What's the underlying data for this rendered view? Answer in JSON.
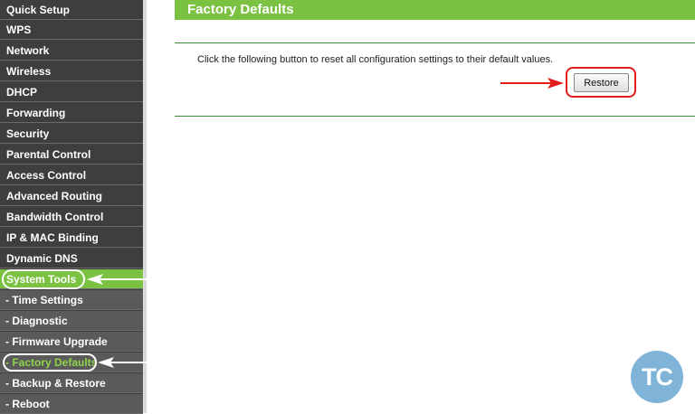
{
  "sidebar": {
    "items": [
      {
        "label": "Quick Setup"
      },
      {
        "label": "WPS"
      },
      {
        "label": "Network"
      },
      {
        "label": "Wireless"
      },
      {
        "label": "DHCP"
      },
      {
        "label": "Forwarding"
      },
      {
        "label": "Security"
      },
      {
        "label": "Parental Control"
      },
      {
        "label": "Access Control"
      },
      {
        "label": "Advanced Routing"
      },
      {
        "label": "Bandwidth Control"
      },
      {
        "label": "IP & MAC Binding"
      },
      {
        "label": "Dynamic DNS"
      },
      {
        "label": "System Tools"
      }
    ],
    "subitems": [
      {
        "label": "- Time Settings"
      },
      {
        "label": "- Diagnostic"
      },
      {
        "label": "- Firmware Upgrade"
      },
      {
        "label": "- Factory Defaults"
      },
      {
        "label": "- Backup & Restore"
      },
      {
        "label": "- Reboot"
      }
    ]
  },
  "main": {
    "title": "Factory Defaults",
    "description": "Click the following button to reset all configuration settings to their default values.",
    "restore_label": "Restore"
  },
  "logo": {
    "text": "TC"
  },
  "colors": {
    "accent": "#7cc242",
    "sidebar": "#3e3e3e",
    "highlight": "#e21b1b"
  }
}
